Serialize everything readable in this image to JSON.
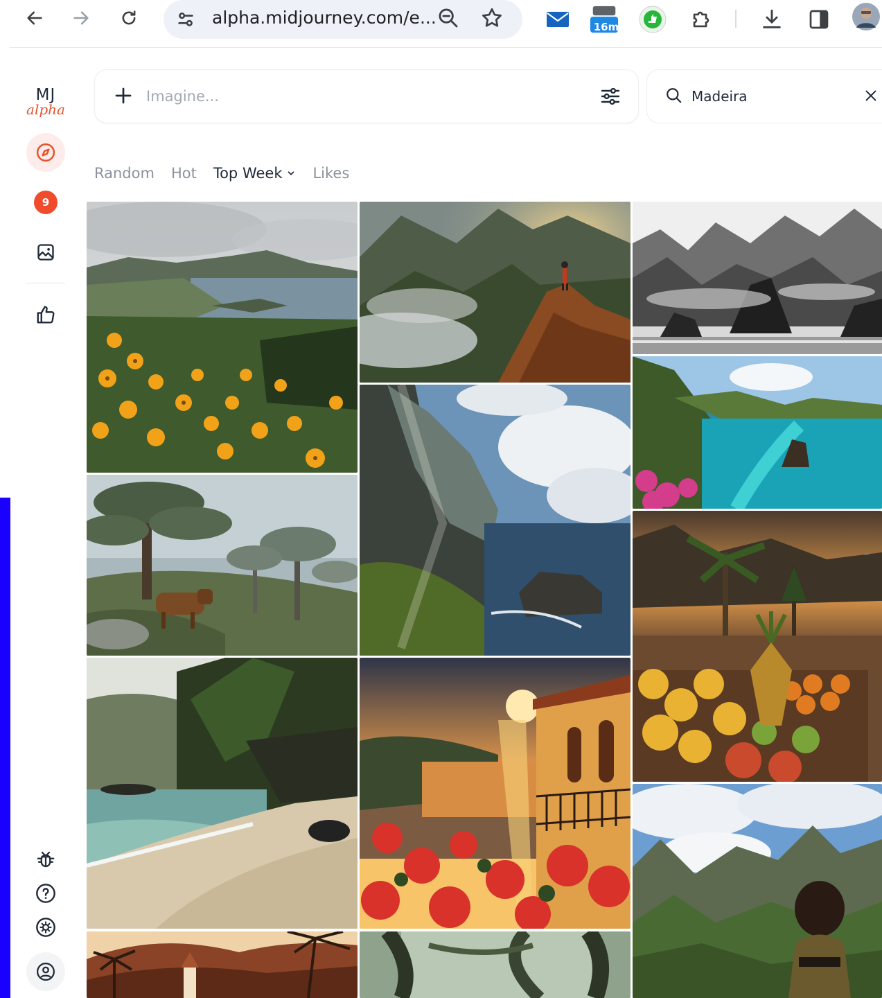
{
  "browser": {
    "url": "alpha.midjourney.com/e...",
    "extension_badge": "16m"
  },
  "sidebar": {
    "logo_mj": "MJ",
    "logo_alpha": "alpha",
    "notification_count": "9"
  },
  "imagine": {
    "placeholder": "Imagine..."
  },
  "search": {
    "value": "Madeira"
  },
  "tabs": [
    {
      "label": "Random"
    },
    {
      "label": "Hot"
    },
    {
      "label": "Top Week"
    },
    {
      "label": "Likes"
    }
  ],
  "colors": {
    "accent": "#ef4b2c",
    "active_bg": "#fdecea",
    "stripe": "#1a00ff"
  }
}
